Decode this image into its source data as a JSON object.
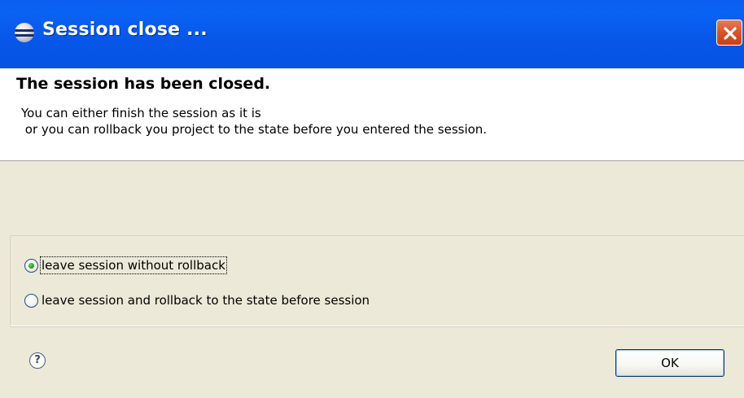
{
  "window": {
    "title": "Session close ...",
    "app_icon": "eclipse-icon",
    "close_icon": "close-icon"
  },
  "header": {
    "title": "The session has been closed.",
    "message": "You can either finish the session as it is\n or you can rollback you project to the state before you entered the session."
  },
  "options": [
    {
      "label": "leave session without rollback",
      "checked": true,
      "focused": true
    },
    {
      "label": "leave session and rollback to the state before session",
      "checked": false,
      "focused": false
    }
  ],
  "footer": {
    "help_symbol": "?",
    "ok_label": "OK"
  },
  "colors": {
    "titlebar": "#0a5ff0",
    "close_button": "#d8532a",
    "dialog_bg": "#ece9d8",
    "header_bg": "#ffffff",
    "radio_checked": "#21a121"
  }
}
